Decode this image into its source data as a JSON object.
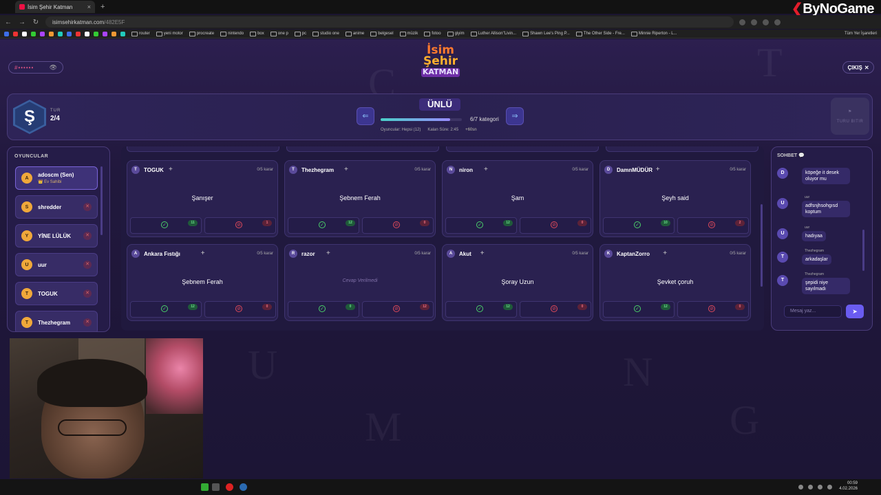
{
  "browser": {
    "tab_title": "İsim Şehir Katman",
    "tab_close": "×",
    "new_tab": "+",
    "url_host": "isimsehirkatman.com",
    "url_path": "/482E5F",
    "watermark": "ByNoGame",
    "bookmarks": [
      "router",
      "yeni motor",
      "procreate",
      "nintendo",
      "box",
      "one p",
      "pc",
      "studio one",
      "anime",
      "belgesel",
      "müzik",
      "fotoo",
      "giyim",
      "Luther Allison\"Livin...",
      "Shawn Lee's Ping P...",
      "The Other Side - Fre...",
      "Minnie Riperton - L..."
    ],
    "bookmarks_right": "Tüm Yer İşaretleri"
  },
  "header": {
    "room_code": "#••••••",
    "eye_icon": "👁",
    "logo": {
      "line1": "İsim",
      "line2": "Şehir",
      "line3": "KATMAN"
    },
    "exit_label": "ÇIKIŞ",
    "exit_icon": "✕"
  },
  "round": {
    "letter": "Ş",
    "tur_label": "TUR",
    "tur_value": "2/4",
    "category": "ÜNLÜ",
    "prev_icon": "⇐",
    "next_icon": "⇒",
    "progress_fraction": 0.857,
    "category_count": "6/7 kategori",
    "players_meta": "Oyuncular: Hepsi (12)",
    "time_meta": "Kalan Süre: 2:45",
    "bonus_meta": "+60sn",
    "finish_label": "TURU BITIR"
  },
  "players": {
    "title": "OYUNCULAR",
    "list": [
      {
        "initial": "A",
        "name": "adoscm (Sen)",
        "sub": "👑 Ev Sahibi",
        "color": "#f0a83a"
      },
      {
        "initial": "S",
        "name": "shredder",
        "sub": "",
        "color": "#f0a83a"
      },
      {
        "initial": "Y",
        "name": "YİNE LÜLÜK",
        "sub": "",
        "color": "#f0a83a"
      },
      {
        "initial": "U",
        "name": "uur",
        "sub": "",
        "color": "#f0a83a"
      },
      {
        "initial": "T",
        "name": "TOGUK",
        "sub": "",
        "color": "#f0a83a"
      },
      {
        "initial": "T",
        "name": "Thezhegram",
        "sub": "",
        "color": "#f0a83a"
      }
    ],
    "kick_icon": "✕"
  },
  "answers": {
    "vote_label": "0/5 karar",
    "plus": "+",
    "ok_icon": "✓",
    "no_icon": "⊘",
    "cards": [
      {
        "initial": "T",
        "name": "TOGUK",
        "answer": "Şanışer",
        "ok": "11",
        "no": "1",
        "empty": false
      },
      {
        "initial": "T",
        "name": "Thezhegram",
        "answer": "Şebnem Ferah",
        "ok": "12",
        "no": "0",
        "empty": false
      },
      {
        "initial": "N",
        "name": "niron",
        "answer": "Şam",
        "ok": "12",
        "no": "0",
        "empty": false
      },
      {
        "initial": "D",
        "name": "DamnMÜDÜR",
        "answer": "Şeyh said",
        "ok": "10",
        "no": "2",
        "empty": false
      },
      {
        "initial": "A",
        "name": "Ankara Fıstığı",
        "answer": "Şebnem Ferah",
        "ok": "12",
        "no": "0",
        "empty": false
      },
      {
        "initial": "R",
        "name": "razor",
        "answer": "Cevap Verilmedi",
        "ok": "0",
        "no": "12",
        "empty": true
      },
      {
        "initial": "A",
        "name": "Akut",
        "answer": "Şoray Uzun",
        "ok": "12",
        "no": "0",
        "empty": false
      },
      {
        "initial": "K",
        "name": "KaptanZorro",
        "answer": "Şevket çoruh",
        "ok": "12",
        "no": "0",
        "empty": false
      }
    ]
  },
  "chat": {
    "title": "SOHBET 💬",
    "messages": [
      {
        "initial": "D",
        "author": "",
        "text": "köpeğe it desek oluyor mu"
      },
      {
        "initial": "U",
        "author": "uur",
        "text": "adfsnjhsohgısd koptum"
      },
      {
        "initial": "U",
        "author": "uur",
        "text": "hadıyaa"
      },
      {
        "initial": "T",
        "author": "Thezhegram",
        "text": "arkadaşlar"
      },
      {
        "initial": "T",
        "author": "Thezhegram",
        "text": "şepidi niye sayılmadı"
      }
    ],
    "input_placeholder": "Mesaj yaz...",
    "send_icon": "➤"
  },
  "taskbar": {
    "time": "00:59",
    "date": "4.02.2026"
  },
  "colors": {
    "accent": "#6a5cf0",
    "ok": "#4ad06a",
    "no": "#e04a5a",
    "page_bg": "#21183d"
  }
}
